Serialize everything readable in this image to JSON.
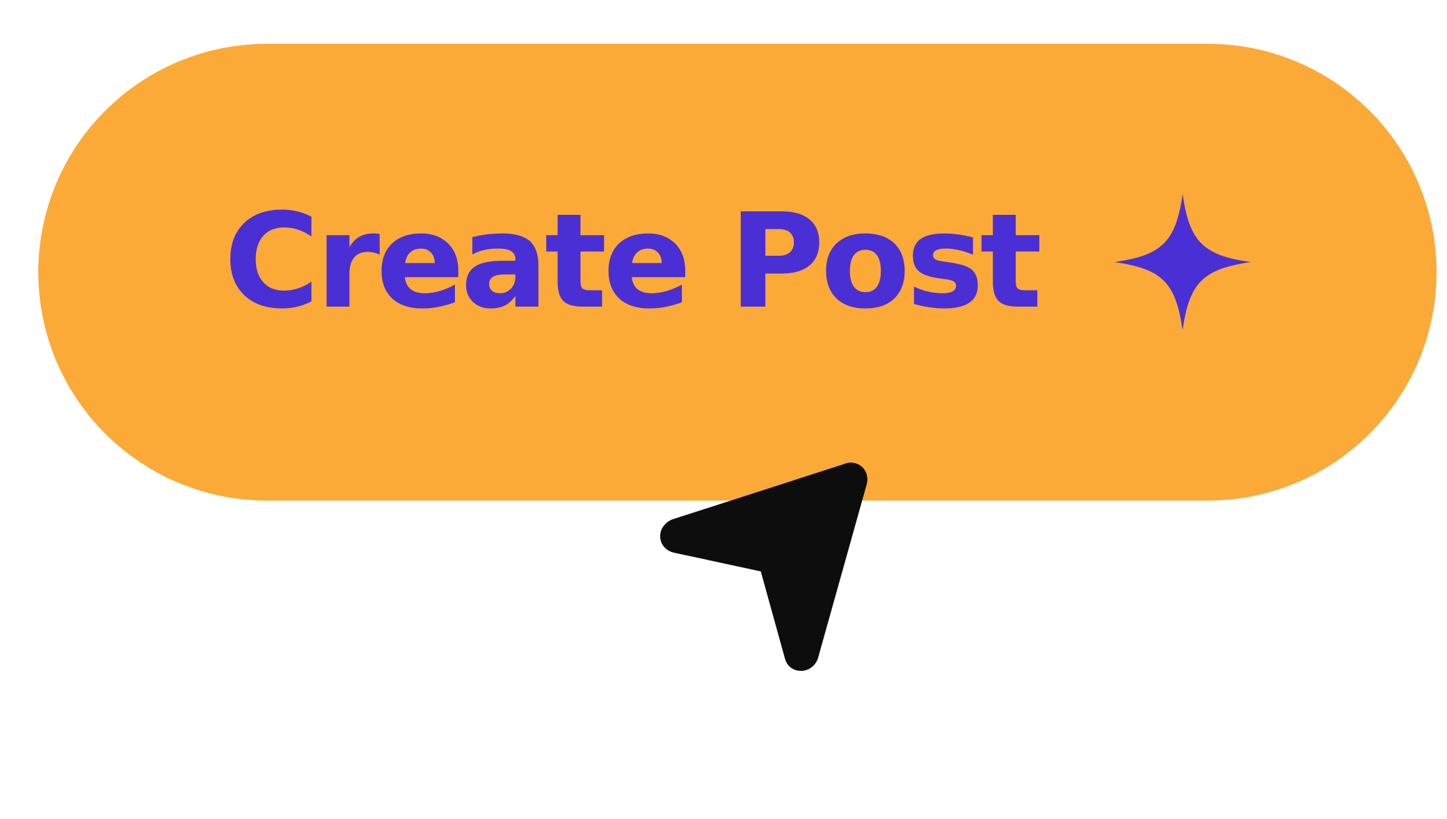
{
  "button": {
    "label": "Create Post",
    "icon": "sparkle-icon",
    "background_color": "#FBAA38",
    "text_color": "#4A2FD4"
  },
  "cursor": {
    "icon": "mouse-pointer-icon",
    "color": "#0D0D0D"
  }
}
